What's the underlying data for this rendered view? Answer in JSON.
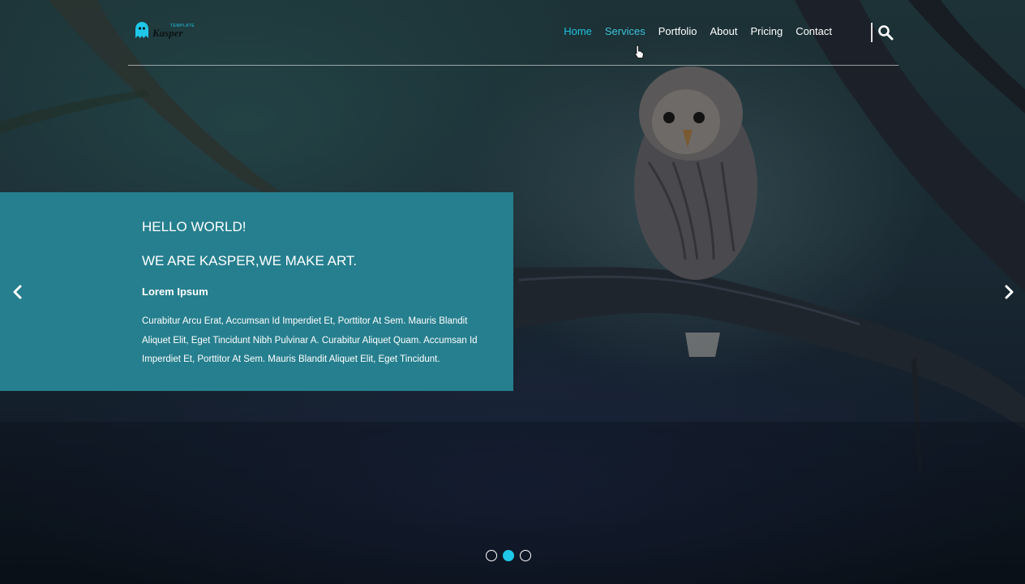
{
  "brand": {
    "tagline": "TEMPLATE",
    "name": "Kasper"
  },
  "nav": {
    "items": [
      {
        "label": "Home",
        "state": "active"
      },
      {
        "label": "Services",
        "state": "hover"
      },
      {
        "label": "Portfolio",
        "state": "normal"
      },
      {
        "label": "About",
        "state": "normal"
      },
      {
        "label": "Pricing",
        "state": "normal"
      },
      {
        "label": "Contact",
        "state": "normal"
      }
    ],
    "search_icon": "search-icon"
  },
  "slide": {
    "kicker": "HELLO WORLD!",
    "headline": "WE ARE KASPER,WE MAKE ART.",
    "subhead": "Lorem Ipsum",
    "body": "Curabitur Arcu Erat, Accumsan Id Imperdiet Et, Porttitor At Sem. Mauris Blandit Aliquet Elit, Eget Tincidunt Nibh Pulvinar A. Curabitur Aliquet Quam. Accumsan Id Imperdiet Et, Porttitor At Sem. Mauris Blandit Aliquet Elit, Eget Tincidunt."
  },
  "slider": {
    "prev_icon": "chevron-left-icon",
    "next_icon": "chevron-right-icon",
    "dots": [
      {
        "active": false
      },
      {
        "active": true
      },
      {
        "active": false
      }
    ]
  },
  "colors": {
    "accent": "#1fc7e8",
    "panel": "#267f8e",
    "nav_active": "#1fc1e0"
  }
}
